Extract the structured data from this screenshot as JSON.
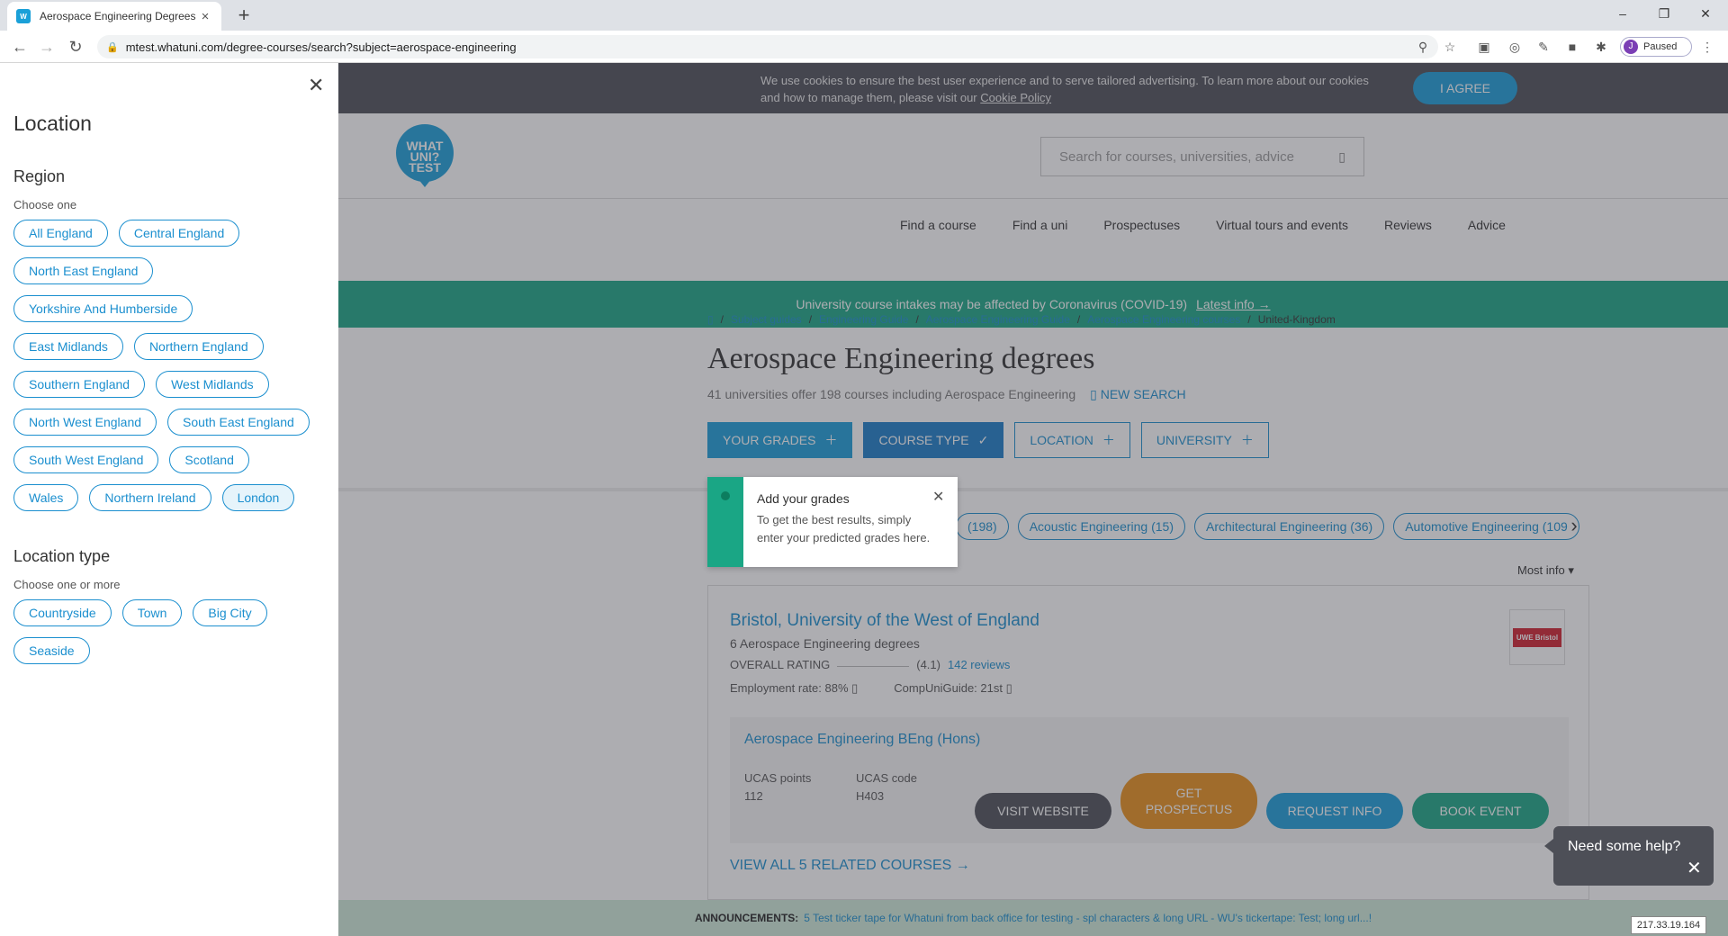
{
  "browser": {
    "tab_title": "Aerospace Engineering Degrees ·",
    "favicon_text": "W",
    "url": "mtest.whatuni.com/degree-courses/search?subject=aerospace-engineering",
    "profile_initial": "J",
    "profile_label": "Paused"
  },
  "cookie_banner": {
    "text": "We use cookies to ensure the best user experience and to serve tailored advertising. To learn more about our cookies and how to manage them, please visit our",
    "link": "Cookie Policy",
    "agree_button": "I AGREE"
  },
  "header": {
    "logo_text": "WHAT UNI? TEST",
    "search_placeholder": "Search for courses, universities, advice",
    "nav": [
      "Find a course",
      "Find a uni",
      "Prospectuses",
      "Virtual tours and events",
      "Reviews",
      "Advice"
    ]
  },
  "covid_banner": {
    "text": "University course intakes may be affected by Coronavirus (COVID-19)",
    "link": "Latest info"
  },
  "breadcrumb": [
    "Subject guides",
    "Engineering Guide",
    "Aerospace Engineering Guide",
    "Aerospace Engineering courses"
  ],
  "breadcrumb_current": "United-Kingdom",
  "title": "Aerospace Engineering degrees",
  "subtitle": "41 universities offer 198 courses including Aerospace Engineering",
  "new_search": "NEW SEARCH",
  "filters": {
    "grades": "YOUR GRADES",
    "course_type": "COURSE TYPE",
    "location": "LOCATION",
    "university": "UNIVERSITY"
  },
  "tooltip": {
    "title": "Add your grades",
    "body": "To get the best results, simply enter your predicted grades here."
  },
  "subject_chips": [
    "(198)",
    "Acoustic Engineering (15)",
    "Architectural Engineering (36)",
    "Automotive Engineering (109"
  ],
  "sort_label": "Most info",
  "result": {
    "university": "Bristol, University of the West of England",
    "degrees": "6 Aerospace Engineering degrees",
    "rating_label": "OVERALL RATING",
    "rating_value": "(4.1)",
    "reviews": "142 reviews",
    "employment": "Employment rate: 88%",
    "compuni": "CompUniGuide: 21st",
    "logo_text": "UWE Bristol",
    "course_title": "Aerospace Engineering BEng (Hons)",
    "ucas_points_label": "UCAS points",
    "ucas_points": "112",
    "ucas_code_label": "UCAS code",
    "ucas_code": "H403",
    "btn_visit": "VISIT WEBSITE",
    "btn_prospectus": "GET PROSPECTUS",
    "btn_request": "REQUEST INFO",
    "btn_event": "BOOK EVENT",
    "view_all": "VIEW ALL 5 RELATED COURSES"
  },
  "ticker": {
    "label": "ANNOUNCEMENTS:",
    "text": "5 Test ticker tape for Whatuni from back office for testing - spl characters & long URL - WU's tickertape: Test; long url...!"
  },
  "help": {
    "text": "Need some help?"
  },
  "ip": "217.33.19.164",
  "sidebar": {
    "title": "Location",
    "region_heading": "Region",
    "region_hint": "Choose one",
    "region_rows": [
      [
        "All England",
        "Central England"
      ],
      [
        "North East England"
      ],
      [
        "Yorkshire And Humberside"
      ],
      [
        "East Midlands",
        "Northern England"
      ],
      [
        "Southern England",
        "West Midlands"
      ],
      [
        "North West England",
        "South East England"
      ],
      [
        "South West England",
        "Scotland"
      ],
      [
        "Wales",
        "Northern Ireland",
        "London"
      ]
    ],
    "selected_region": "London",
    "location_type_heading": "Location type",
    "location_type_hint": "Choose one or more",
    "type_rows": [
      [
        "Countryside",
        "Town",
        "Big City"
      ],
      [
        "Seaside"
      ]
    ]
  },
  "colors": {
    "brand_blue": "#1b9dd9",
    "green": "#1aa685",
    "orange": "#e8901b",
    "dark_grey": "#4d4f57"
  }
}
